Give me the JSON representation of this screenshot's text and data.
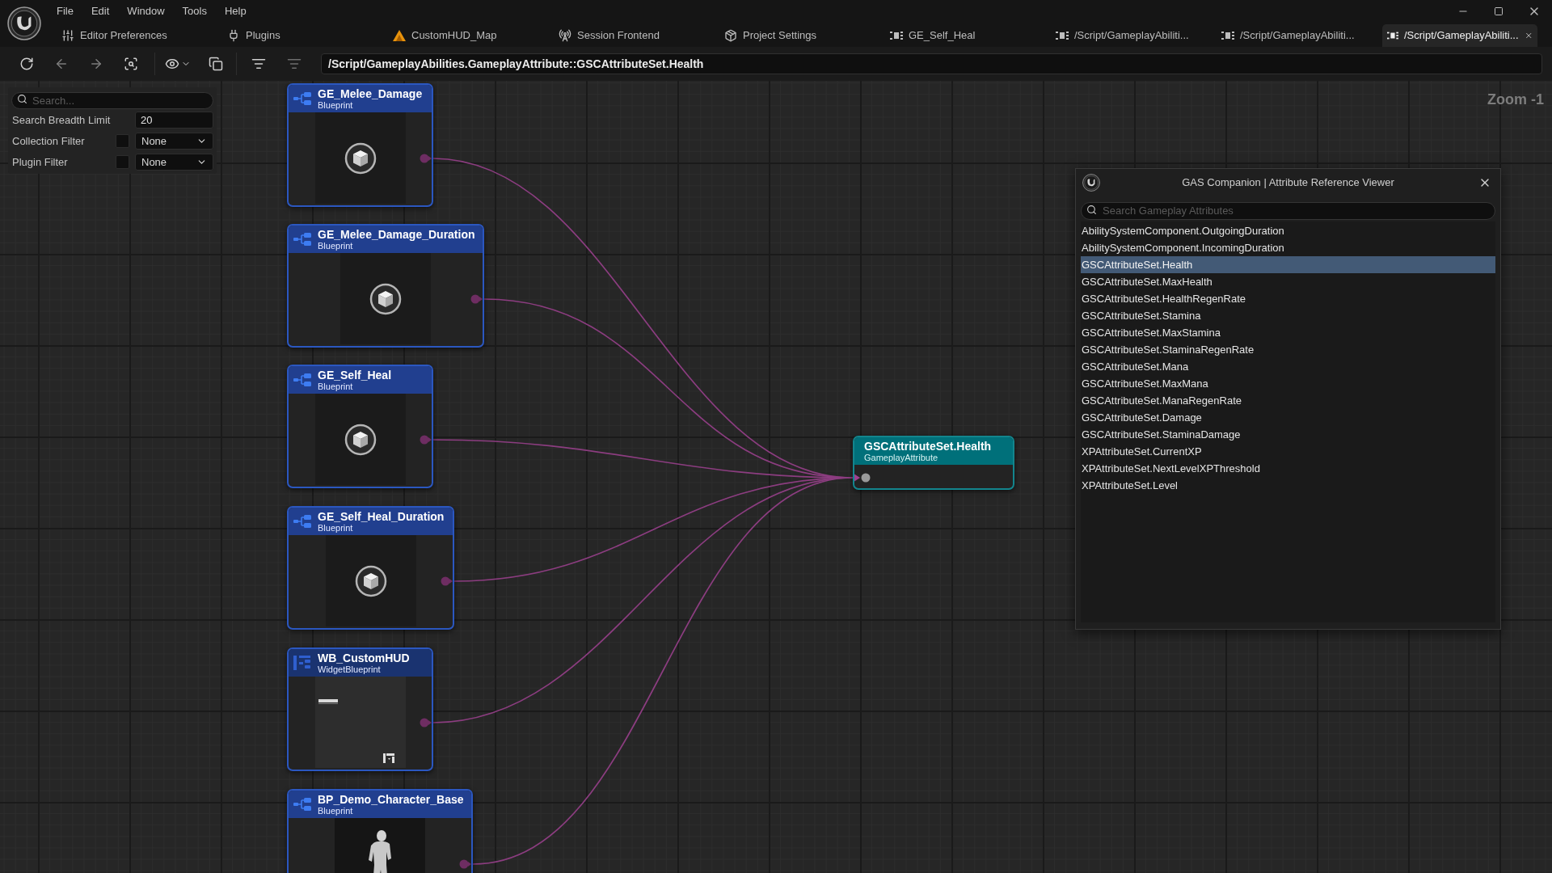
{
  "window": {
    "menu": [
      "File",
      "Edit",
      "Window",
      "Tools",
      "Help"
    ]
  },
  "tabs": [
    {
      "label": "Editor Preferences",
      "kind": "preferences",
      "selected": false
    },
    {
      "label": "Plugins",
      "kind": "plugins",
      "selected": false
    },
    {
      "label": "CustomHUD_Map",
      "kind": "map",
      "selected": false
    },
    {
      "label": "Session Frontend",
      "kind": "session",
      "selected": false
    },
    {
      "label": "Project Settings",
      "kind": "project",
      "selected": false
    },
    {
      "label": "GE_Self_Heal",
      "kind": "asset",
      "selected": false
    },
    {
      "label": "/Script/GameplayAbiliti...",
      "kind": "asset",
      "selected": false
    },
    {
      "label": "/Script/GameplayAbiliti...",
      "kind": "asset",
      "selected": false
    },
    {
      "label": "/Script/GameplayAbiliti...",
      "kind": "asset",
      "selected": true
    }
  ],
  "toolbar": {
    "path": "/Script/GameplayAbilities.GameplayAttribute::GSCAttributeSet.Health"
  },
  "filters": {
    "search": {
      "placeholder": "Search..."
    },
    "rows": [
      {
        "label": "Search Breadth Limit",
        "kind": "number",
        "value": "20"
      },
      {
        "label": "Collection Filter",
        "kind": "dropdown",
        "checked": false,
        "value": "None"
      },
      {
        "label": "Plugin Filter",
        "kind": "dropdown",
        "checked": false,
        "value": "None"
      }
    ]
  },
  "graph": {
    "zoom": "Zoom -1",
    "nodes": [
      {
        "title": "GE_Melee_Damage",
        "type": "Blueprint",
        "kind": "blueprint"
      },
      {
        "title": "GE_Melee_Damage_Duration",
        "type": "Blueprint",
        "kind": "blueprint"
      },
      {
        "title": "GE_Self_Heal",
        "type": "Blueprint",
        "kind": "blueprint"
      },
      {
        "title": "GE_Self_Heal_Duration",
        "type": "Blueprint",
        "kind": "blueprint"
      },
      {
        "title": "WB_CustomHUD",
        "type": "WidgetBlueprint",
        "kind": "widget"
      },
      {
        "title": "BP_Demo_Character_Base",
        "type": "Blueprint",
        "kind": "character"
      }
    ],
    "target": {
      "title": "GSCAttributeSet.Health",
      "type": "GameplayAttribute"
    }
  },
  "viewer": {
    "title": "GAS Companion | Attribute Reference Viewer",
    "search": {
      "placeholder": "Search Gameplay Attributes"
    },
    "items": [
      {
        "label": "AbilitySystemComponent.OutgoingDuration",
        "selected": false
      },
      {
        "label": "AbilitySystemComponent.IncomingDuration",
        "selected": false
      },
      {
        "label": "GSCAttributeSet.Health",
        "selected": true
      },
      {
        "label": "GSCAttributeSet.MaxHealth",
        "selected": false
      },
      {
        "label": "GSCAttributeSet.HealthRegenRate",
        "selected": false
      },
      {
        "label": "GSCAttributeSet.Stamina",
        "selected": false
      },
      {
        "label": "GSCAttributeSet.MaxStamina",
        "selected": false
      },
      {
        "label": "GSCAttributeSet.StaminaRegenRate",
        "selected": false
      },
      {
        "label": "GSCAttributeSet.Mana",
        "selected": false
      },
      {
        "label": "GSCAttributeSet.MaxMana",
        "selected": false
      },
      {
        "label": "GSCAttributeSet.ManaRegenRate",
        "selected": false
      },
      {
        "label": "GSCAttributeSet.Damage",
        "selected": false
      },
      {
        "label": "GSCAttributeSet.StaminaDamage",
        "selected": false
      },
      {
        "label": "XPAttributeSet.CurrentXP",
        "selected": false
      },
      {
        "label": "XPAttributeSet.NextLevelXPThreshold",
        "selected": false
      },
      {
        "label": "XPAttributeSet.Level",
        "selected": false
      }
    ]
  }
}
